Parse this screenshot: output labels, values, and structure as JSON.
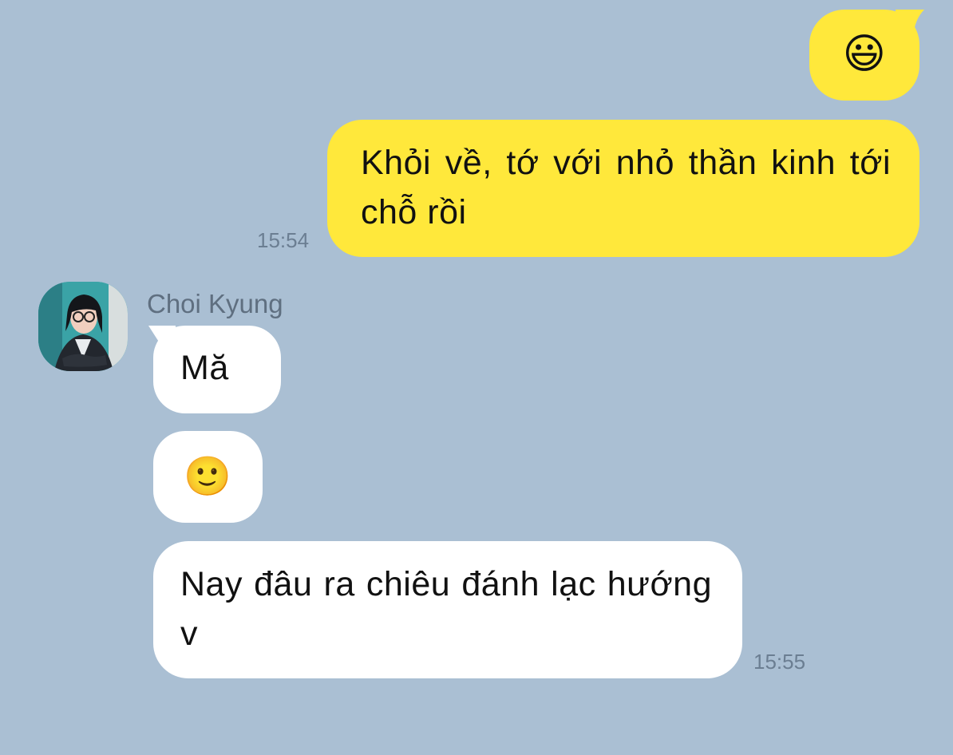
{
  "chat": {
    "messages": [
      {
        "from": "me",
        "type": "emoji",
        "text": "😃"
      },
      {
        "from": "me",
        "type": "text",
        "text": "Khỏi về, tớ với nhỏ thần kinh tới chỗ rồi",
        "time": "15:54"
      },
      {
        "from": "them",
        "type": "text",
        "text": "Mă"
      },
      {
        "from": "them",
        "type": "emoji",
        "text": "🙂"
      },
      {
        "from": "them",
        "type": "text",
        "text": "Nay đâu ra chiêu đánh lạc hướng v",
        "time": "15:55"
      }
    ],
    "contact": {
      "name": "Choi Kyung"
    }
  },
  "colors": {
    "background": "#aabfd3",
    "my_bubble": "#ffe83b",
    "their_bubble": "#ffffff",
    "timestamp": "#6b7e92"
  }
}
